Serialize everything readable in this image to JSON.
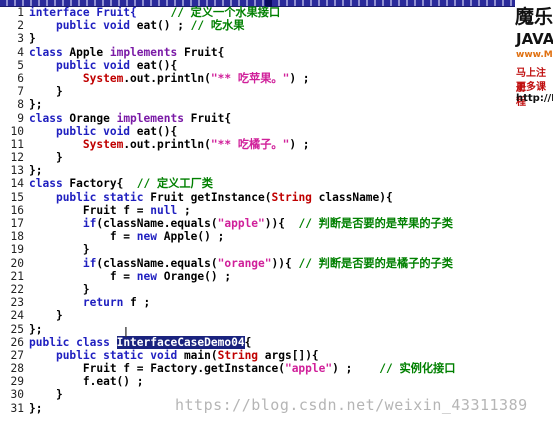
{
  "lines": [
    {
      "n": "1",
      "tokens": [
        [
          "interface Fruit{",
          "kw2"
        ],
        [
          "     // 定义一个水果接口",
          "com"
        ]
      ]
    },
    {
      "n": "2",
      "tokens": [
        [
          "    ",
          ""
        ],
        [
          "public void",
          "kw2"
        ],
        [
          " eat() ; ",
          ""
        ],
        [
          "// 吃水果",
          "com"
        ]
      ]
    },
    {
      "n": "3",
      "tokens": [
        [
          "}",
          ""
        ]
      ]
    },
    {
      "n": "4",
      "tokens": [
        [
          "class",
          "kw2"
        ],
        [
          " Apple ",
          ""
        ],
        [
          "implements",
          "kw"
        ],
        [
          " Fruit{",
          ""
        ]
      ]
    },
    {
      "n": "5",
      "tokens": [
        [
          "    ",
          ""
        ],
        [
          "public void",
          "kw2"
        ],
        [
          " eat(){",
          ""
        ]
      ]
    },
    {
      "n": "6",
      "tokens": [
        [
          "        ",
          ""
        ],
        [
          "System",
          "sys"
        ],
        [
          ".out.println(",
          ""
        ],
        [
          "\"** 吃苹果。\"",
          "str"
        ],
        [
          ") ;",
          ""
        ]
      ]
    },
    {
      "n": "7",
      "tokens": [
        [
          "    }",
          ""
        ]
      ]
    },
    {
      "n": "8",
      "tokens": [
        [
          "};",
          ""
        ]
      ]
    },
    {
      "n": "9",
      "tokens": [
        [
          "class",
          "kw2"
        ],
        [
          " Orange ",
          ""
        ],
        [
          "implements",
          "kw"
        ],
        [
          " Fruit{",
          ""
        ]
      ]
    },
    {
      "n": "10",
      "tokens": [
        [
          "    ",
          ""
        ],
        [
          "public void",
          "kw2"
        ],
        [
          " eat(){",
          ""
        ]
      ]
    },
    {
      "n": "11",
      "tokens": [
        [
          "        ",
          ""
        ],
        [
          "System",
          "sys"
        ],
        [
          ".out.println(",
          ""
        ],
        [
          "\"** 吃橘子。\"",
          "str"
        ],
        [
          ") ;",
          ""
        ]
      ]
    },
    {
      "n": "12",
      "tokens": [
        [
          "    }",
          ""
        ]
      ]
    },
    {
      "n": "13",
      "tokens": [
        [
          "};",
          ""
        ]
      ]
    },
    {
      "n": "14",
      "tokens": [
        [
          "class",
          "kw2"
        ],
        [
          " Factory{  ",
          ""
        ],
        [
          "// 定义工厂类",
          "com"
        ]
      ]
    },
    {
      "n": "15",
      "tokens": [
        [
          "    ",
          ""
        ],
        [
          "public static",
          "kw2"
        ],
        [
          " Fruit getInstance(",
          ""
        ],
        [
          "String",
          "sys"
        ],
        [
          " className){",
          ""
        ]
      ]
    },
    {
      "n": "16",
      "tokens": [
        [
          "        Fruit f = ",
          ""
        ],
        [
          "null",
          "kw2"
        ],
        [
          " ;",
          ""
        ]
      ]
    },
    {
      "n": "17",
      "tokens": [
        [
          "        ",
          ""
        ],
        [
          "if",
          "kw2"
        ],
        [
          "(className.equals(",
          ""
        ],
        [
          "\"apple\"",
          "str"
        ],
        [
          ")){  ",
          ""
        ],
        [
          "// 判断是否要的是苹果的子类",
          "com"
        ]
      ]
    },
    {
      "n": "18",
      "tokens": [
        [
          "            f = ",
          ""
        ],
        [
          "new",
          "kw2"
        ],
        [
          " Apple() ;",
          ""
        ]
      ]
    },
    {
      "n": "19",
      "tokens": [
        [
          "        }",
          ""
        ]
      ]
    },
    {
      "n": "20",
      "tokens": [
        [
          "        ",
          ""
        ],
        [
          "if",
          "kw2"
        ],
        [
          "(className.equals(",
          ""
        ],
        [
          "\"orange\"",
          "str"
        ],
        [
          ")){ ",
          ""
        ],
        [
          "// 判断是否要的是橘子的子类",
          "com"
        ]
      ]
    },
    {
      "n": "21",
      "tokens": [
        [
          "            f = ",
          ""
        ],
        [
          "new",
          "kw2"
        ],
        [
          " Orange() ;",
          ""
        ]
      ]
    },
    {
      "n": "22",
      "tokens": [
        [
          "        }",
          ""
        ]
      ]
    },
    {
      "n": "23",
      "tokens": [
        [
          "        ",
          ""
        ],
        [
          "return",
          "kw2"
        ],
        [
          " f ;",
          ""
        ]
      ]
    },
    {
      "n": "24",
      "tokens": [
        [
          "    }",
          ""
        ]
      ]
    },
    {
      "n": "25",
      "tokens": [
        [
          "};",
          ""
        ]
      ]
    },
    {
      "n": "26",
      "tokens": [
        [
          "public class",
          "kw2"
        ],
        [
          " ",
          ""
        ],
        [
          "InterfaceCaseDemo04",
          "sel"
        ],
        [
          "{",
          ""
        ]
      ]
    },
    {
      "n": "27",
      "tokens": [
        [
          "    ",
          ""
        ],
        [
          "public static void",
          "kw2"
        ],
        [
          " main(",
          ""
        ],
        [
          "String",
          "sys"
        ],
        [
          " args[]){",
          ""
        ]
      ]
    },
    {
      "n": "28",
      "tokens": [
        [
          "        Fruit f = Factory.getInstance(",
          ""
        ],
        [
          "\"apple\"",
          "str"
        ],
        [
          ") ;    ",
          ""
        ],
        [
          "// 实例化接口",
          "com"
        ]
      ]
    },
    {
      "n": "29",
      "tokens": [
        [
          "        f.eat() ;",
          ""
        ]
      ]
    },
    {
      "n": "30",
      "tokens": [
        [
          "    }",
          ""
        ]
      ]
    },
    {
      "n": "31",
      "tokens": [
        [
          "};",
          ""
        ]
      ]
    }
  ],
  "cursor_glyph": "I",
  "watermark": "https://blog.csdn.net/weixin_43311389",
  "ad": {
    "title": "魔乐",
    "java": "JAVA",
    "url": "www.M",
    "line1": "马上注册",
    "line2": "更多课程",
    "line3": "http://B"
  },
  "colors": {
    "keyword": "#2020c0",
    "implements": "#7a1aa6",
    "string": "#d0209a",
    "comment": "#008000",
    "system_type": "#c00000",
    "selection_bg": "#1a237e"
  }
}
